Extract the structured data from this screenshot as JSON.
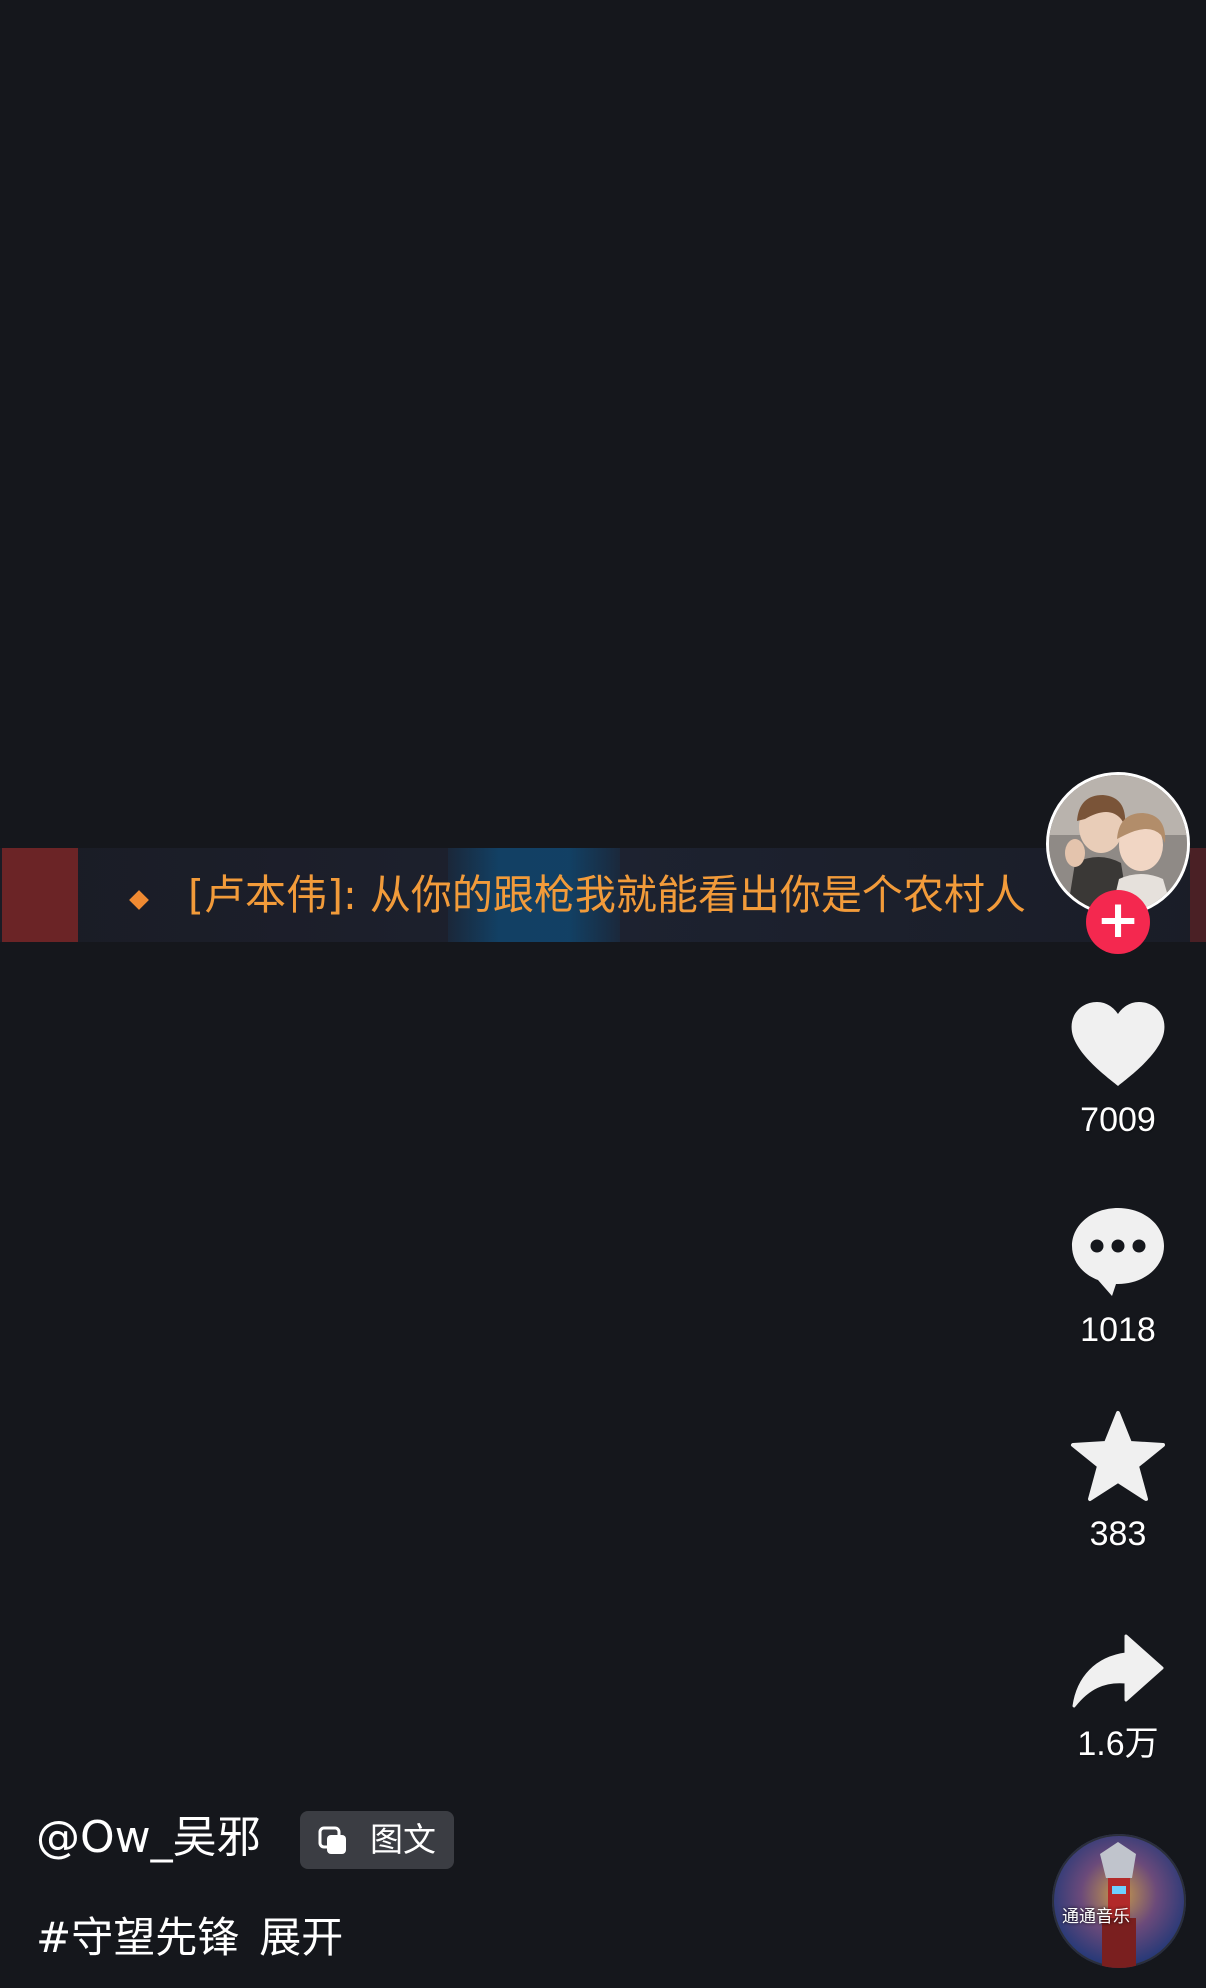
{
  "subtitle": {
    "text": "[卢本伟]: 从你的跟枪我就能看出你是个农村人"
  },
  "creator": {
    "follow_symbol": "+"
  },
  "actions": {
    "likes": "7009",
    "comments": "1018",
    "favorites": "383",
    "shares": "1.6万"
  },
  "music": {
    "disc_label": "通通音乐"
  },
  "post": {
    "author": "@Ow_吴邪",
    "type_badge": "图文",
    "hashtag": "#守望先锋",
    "expand": "展开"
  },
  "colors": {
    "background": "#15171c",
    "subtitle_text": "#f29b3a",
    "follow_button": "#f4284f",
    "badge_bg": "#3b3d43"
  },
  "icons": {
    "like": "heart-icon",
    "comment": "comment-bubble-icon",
    "favorite": "star-icon",
    "share": "share-arrow-icon",
    "badge": "images-stack-icon"
  }
}
